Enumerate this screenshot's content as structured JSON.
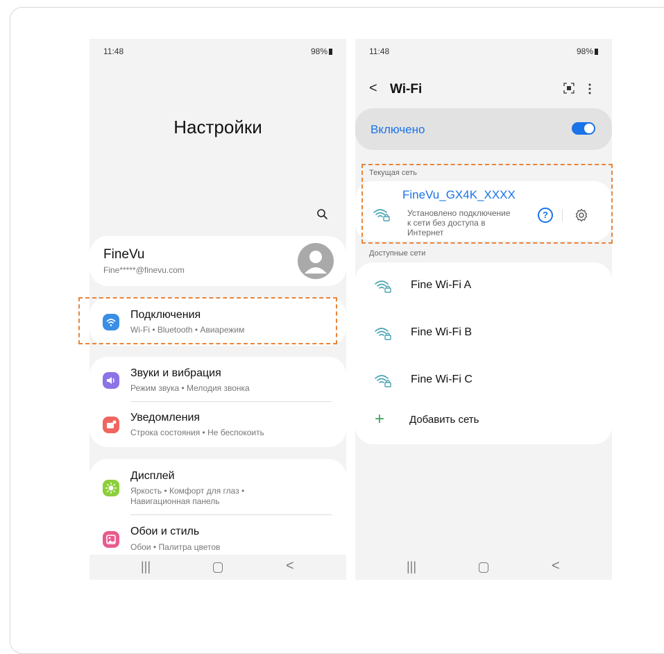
{
  "left": {
    "status": {
      "time": "11:48",
      "battery": "98%"
    },
    "title": "Настройки",
    "account": {
      "name": "FineVu",
      "email": "Fine*****@finevu.com"
    },
    "items": [
      {
        "title": "Подключения",
        "subtitle": "Wi-Fi • Bluetooth • Авиарежим"
      },
      {
        "title": "Звуки и вибрация",
        "subtitle": "Режим звука • Мелодия звонка"
      },
      {
        "title": "Уведомления",
        "subtitle": "Строка состояния • Не беспокоить"
      },
      {
        "title": "Дисплей",
        "subtitle_line1": "Яркость • Комфорт для глаз •",
        "subtitle_line2": "Навигационная панель"
      },
      {
        "title": "Обои и стиль",
        "subtitle": "Обои • Палитра цветов"
      }
    ],
    "icon_colors": {
      "connections": "#3a8ee6",
      "sounds": "#8c73e6",
      "notifications": "#f0655f",
      "display": "#8bcf3a",
      "wallpaper": "#e85b8f"
    }
  },
  "right": {
    "status": {
      "time": "11:48",
      "battery": "98%"
    },
    "header_title": "Wi-Fi",
    "toggle_label": "Включено",
    "toggle_on": true,
    "current_section": "Текущая сеть",
    "current_network": {
      "ssid": "FineVu_GX4K_XXXX",
      "status_line1": "Установлено подключение",
      "status_line2": "к сети без доступа в",
      "status_line3": "Интернет"
    },
    "available_section": "Доступные сети",
    "networks": [
      "Fine Wi-Fi A",
      "Fine Wi-Fi B",
      "Fine Wi-Fi C"
    ],
    "add_network": "Добавить сеть",
    "accent": "#1a73e8",
    "wifi_icon_color": "#4aa3b5"
  },
  "highlight_color": "#e8843a"
}
